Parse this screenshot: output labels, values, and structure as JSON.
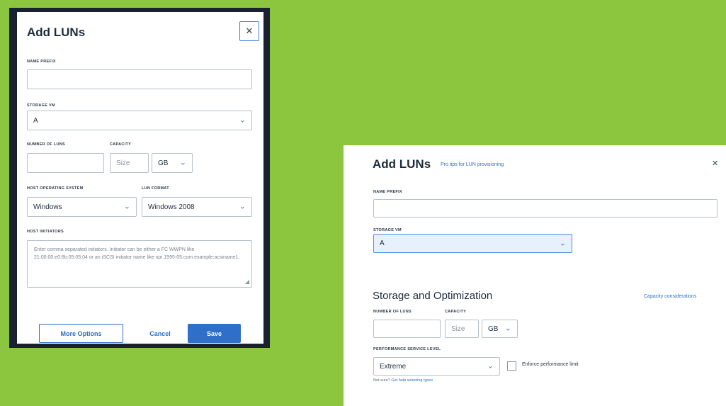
{
  "old_dialog": {
    "title": "Add LUNs",
    "close": "✕",
    "name_prefix_label": "NAME PREFIX",
    "name_prefix_value": "",
    "storage_vm_label": "STORAGE VM",
    "storage_vm_value": "A",
    "number_of_luns_label": "NUMBER OF LUNS",
    "number_of_luns_value": "",
    "capacity_label": "CAPACITY",
    "capacity_placeholder": "Size",
    "capacity_unit": "GB",
    "host_os_label": "HOST OPERATING SYSTEM",
    "host_os_value": "Windows",
    "lun_format_label": "LUN FORMAT",
    "lun_format_value": "Windows 2008",
    "host_initiators_label": "HOST INITIATORS",
    "host_initiators_placeholder": "Enter comma separated initiators. Initiator can be either a FC WWPN like 21:00:00:e0:8b:05:05:04 or an iSCSI initiator name like iqn.1995-05.com.example:acsiname1.",
    "more_options": "More Options",
    "cancel": "Cancel",
    "save": "Save"
  },
  "new_dialog": {
    "title": "Add LUNs",
    "pro_tips": "Pro tips for LUN provisioning",
    "close": "✕",
    "name_prefix_label": "NAME PREFIX",
    "name_prefix_value": "",
    "storage_vm_label": "STORAGE VM",
    "storage_vm_value": "A",
    "section_title": "Storage and Optimization",
    "capacity_considerations": "Capacity considerations",
    "number_of_luns_label": "NUMBER OF LUNS",
    "number_of_luns_value": "",
    "capacity_label": "CAPACITY",
    "capacity_placeholder": "Size",
    "capacity_unit": "GB",
    "performance_label": "PERFORMANCE SERVICE LEVEL",
    "performance_value": "Extreme",
    "enforce_limit": "Enforce performance limit",
    "not_sure": "Not sure?",
    "help_link": "Get help selecting types"
  },
  "colors": {
    "background": "#8cc63f",
    "accent": "#2f6fc9"
  },
  "icons": {
    "chevron": "chevron-down-icon",
    "close": "close-icon",
    "resize": "resize-handle-icon"
  }
}
